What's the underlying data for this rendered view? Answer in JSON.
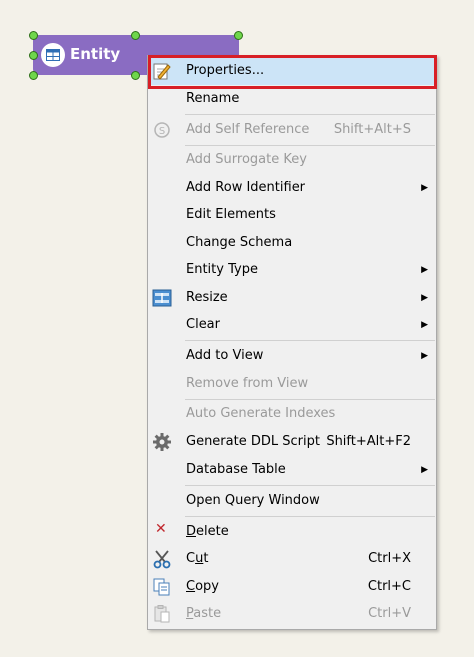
{
  "entity": {
    "label": "Entity",
    "color": "#8a6cc2"
  },
  "menu": {
    "highlight_color": "#d81f26",
    "items": [
      {
        "label": "Properties...",
        "shortcut": "",
        "submenu": false,
        "disabled": false,
        "icon": "properties-icon"
      },
      {
        "label": "Rename",
        "shortcut": "",
        "submenu": false,
        "disabled": false,
        "icon": ""
      },
      {
        "label": "Add Self Reference",
        "shortcut": "Shift+Alt+S",
        "submenu": false,
        "disabled": true,
        "icon": "self-reference-icon"
      },
      {
        "label": "Add Surrogate Key",
        "shortcut": "",
        "submenu": false,
        "disabled": true,
        "icon": ""
      },
      {
        "label": "Add Row Identifier",
        "shortcut": "",
        "submenu": true,
        "disabled": false,
        "icon": ""
      },
      {
        "label": "Edit Elements",
        "shortcut": "",
        "submenu": false,
        "disabled": false,
        "icon": ""
      },
      {
        "label": "Change Schema",
        "shortcut": "",
        "submenu": false,
        "disabled": false,
        "icon": ""
      },
      {
        "label": "Entity Type",
        "shortcut": "",
        "submenu": true,
        "disabled": false,
        "icon": ""
      },
      {
        "label": "Resize",
        "shortcut": "",
        "submenu": true,
        "disabled": false,
        "icon": "resize-icon"
      },
      {
        "label": "Clear",
        "shortcut": "",
        "submenu": true,
        "disabled": false,
        "icon": ""
      },
      {
        "label": "Add to View",
        "shortcut": "",
        "submenu": true,
        "disabled": false,
        "icon": ""
      },
      {
        "label": "Remove from View",
        "shortcut": "",
        "submenu": false,
        "disabled": true,
        "icon": ""
      },
      {
        "label": "Auto Generate Indexes",
        "shortcut": "",
        "submenu": false,
        "disabled": true,
        "icon": ""
      },
      {
        "label": "Generate DDL Script",
        "shortcut": "Shift+Alt+F2",
        "submenu": false,
        "disabled": false,
        "icon": "gear-icon"
      },
      {
        "label": "Database Table",
        "shortcut": "",
        "submenu": true,
        "disabled": false,
        "icon": ""
      },
      {
        "label": "Open Query Window",
        "shortcut": "",
        "submenu": false,
        "disabled": false,
        "icon": ""
      },
      {
        "label_u": "D",
        "label_rest": "elete",
        "shortcut": "",
        "submenu": false,
        "disabled": false,
        "icon": "delete-icon"
      },
      {
        "label_pre": "C",
        "label_u": "u",
        "label_rest": "t",
        "shortcut": "Ctrl+X",
        "submenu": false,
        "disabled": false,
        "icon": "scissors-icon"
      },
      {
        "label_u": "C",
        "label_rest": "opy",
        "shortcut": "Ctrl+C",
        "submenu": false,
        "disabled": false,
        "icon": "copy-icon"
      },
      {
        "label_u": "P",
        "label_rest": "aste",
        "shortcut": "Ctrl+V",
        "submenu": false,
        "disabled": true,
        "icon": "paste-icon"
      }
    ]
  }
}
